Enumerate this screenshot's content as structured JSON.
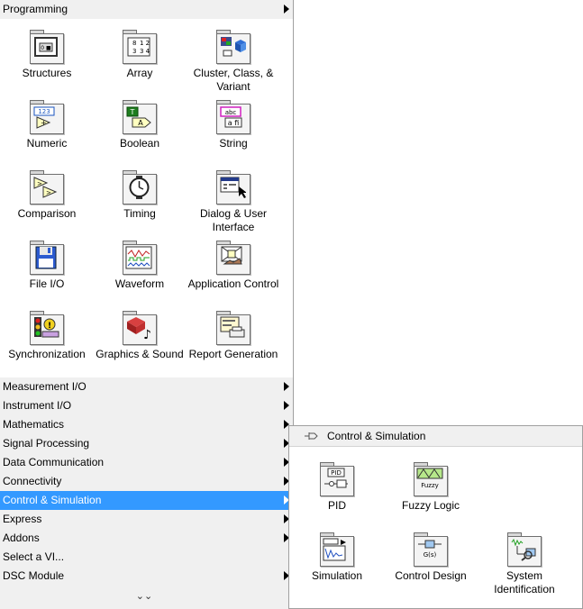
{
  "palette": {
    "header": {
      "label": "Programming"
    },
    "tiles": [
      {
        "label": "Structures"
      },
      {
        "label": "Array"
      },
      {
        "label": "Cluster, Class, & Variant"
      },
      {
        "label": "Numeric"
      },
      {
        "label": "Boolean"
      },
      {
        "label": "String"
      },
      {
        "label": "Comparison"
      },
      {
        "label": "Timing"
      },
      {
        "label": "Dialog & User Interface"
      },
      {
        "label": "File I/O"
      },
      {
        "label": "Waveform"
      },
      {
        "label": "Application Control"
      },
      {
        "label": "Synchronization"
      },
      {
        "label": "Graphics & Sound"
      },
      {
        "label": "Report Generation"
      }
    ],
    "menu": [
      {
        "label": "Measurement I/O",
        "submenu": true
      },
      {
        "label": "Instrument I/O",
        "submenu": true
      },
      {
        "label": "Mathematics",
        "submenu": true
      },
      {
        "label": "Signal Processing",
        "submenu": true
      },
      {
        "label": "Data Communication",
        "submenu": true
      },
      {
        "label": "Connectivity",
        "submenu": true
      },
      {
        "label": "Control & Simulation",
        "submenu": true,
        "selected": true
      },
      {
        "label": "Express",
        "submenu": true
      },
      {
        "label": "Addons",
        "submenu": true
      },
      {
        "label": "Select a VI...",
        "submenu": false
      },
      {
        "label": "DSC Module",
        "submenu": true
      }
    ],
    "scroll_down_glyph": "⌄⌄"
  },
  "subpalette": {
    "title": "Control & Simulation",
    "tiles": [
      {
        "label": "PID",
        "icon_text": "PID"
      },
      {
        "label": "Fuzzy Logic",
        "icon_text": "Fuzzy"
      },
      {
        "label": "Simulation",
        "icon_text": ""
      },
      {
        "label": "Control Design",
        "icon_text": "G(s)"
      },
      {
        "label": "System Identification",
        "icon_text": ""
      }
    ]
  },
  "colors": {
    "highlight": "#3399ff",
    "menu_bg": "#f0f0f0"
  }
}
